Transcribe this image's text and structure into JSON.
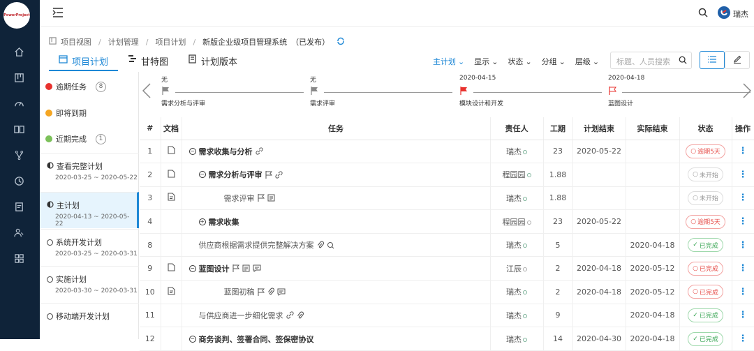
{
  "brand": {
    "logo_text": "PowerProject"
  },
  "sidebar": {
    "icons": [
      "home-icon",
      "board-icon",
      "dashboard-icon",
      "book-icon",
      "branch-icon",
      "clock-icon",
      "report-icon",
      "users-icon",
      "grid-icon"
    ]
  },
  "topbar": {
    "user_name": "瑞杰"
  },
  "breadcrumb": {
    "items": [
      "项目视图",
      "计划管理",
      "项目计划"
    ],
    "current": "新版企业级项目管理系统",
    "status": "（已发布）"
  },
  "tabs": [
    {
      "label": "项目计划",
      "active": true
    },
    {
      "label": "甘特图",
      "active": false
    },
    {
      "label": "计划版本",
      "active": false
    }
  ],
  "filters": [
    {
      "label": "主计划",
      "active": true
    },
    {
      "label": "显示"
    },
    {
      "label": "状态"
    },
    {
      "label": "分组"
    },
    {
      "label": "层级"
    }
  ],
  "search": {
    "placeholder": "标题、人员搜索"
  },
  "left_panel": {
    "alerts": [
      {
        "label": "逾期任务",
        "color": "#e8322e",
        "count": "8"
      },
      {
        "label": "即将到期",
        "color": "#f5a623",
        "count": ""
      },
      {
        "label": "近期完成",
        "color": "#7cc15a",
        "count": "1"
      }
    ],
    "plans": [
      {
        "name": "查看完整计划",
        "dates": "2020-03-25 ~ 2020-05-22",
        "active": false
      },
      {
        "name": "主计划",
        "dates": "2020-04-13 ~ 2020-05-22",
        "active": true
      },
      {
        "name": "系统开发计划",
        "dates": "2020-03-25 ~ 2020-03-31",
        "active": false
      },
      {
        "name": "实施计划",
        "dates": "2020-03-30 ~ 2020-03-31",
        "active": false
      },
      {
        "name": "移动端开发计划",
        "dates": "",
        "active": false
      }
    ]
  },
  "milestones": [
    {
      "date": "无",
      "name": "需求分析与评审",
      "flag_color": "#888"
    },
    {
      "date": "无",
      "name": "需求评审",
      "flag_color": "#888"
    },
    {
      "date": "2020-04-15",
      "name": "模块设计和开发",
      "flag_color": "#e8322e"
    },
    {
      "date": "2020-04-18",
      "name": "蓝图设计",
      "flag_color": "#e8322e"
    }
  ],
  "table": {
    "headers": [
      "#",
      "文档",
      "任务",
      "责任人",
      "工期",
      "计划结束",
      "实际结束",
      "状态",
      "操作"
    ],
    "rows": [
      {
        "num": "1",
        "doc": "doc",
        "indent": 0,
        "toggle": "minus",
        "bold": true,
        "task": "需求收集与分析",
        "icons": [
          "link"
        ],
        "owner": "瑞杰",
        "owner_ok": true,
        "duration": "23",
        "plan_end": "2020-05-22",
        "actual_end": "",
        "status": "逾期5天",
        "status_type": "red"
      },
      {
        "num": "2",
        "doc": "doc",
        "indent": 1,
        "toggle": "minus",
        "bold": true,
        "task": "需求分析与评审",
        "icons": [
          "flag",
          "link"
        ],
        "owner": "程园园",
        "owner_ok": true,
        "duration": "1.88",
        "plan_end": "",
        "actual_end": "",
        "status": "未开始",
        "status_type": "grey"
      },
      {
        "num": "3",
        "doc": "doc2",
        "indent": 2,
        "toggle": "",
        "bold": false,
        "task": "需求评审",
        "icons": [
          "flag",
          "list"
        ],
        "owner": "瑞杰",
        "owner_ok": true,
        "duration": "1.88",
        "plan_end": "",
        "actual_end": "",
        "status": "未开始",
        "status_type": "grey"
      },
      {
        "num": "4",
        "doc": "",
        "indent": 1,
        "toggle": "plus",
        "bold": true,
        "task": "需求收集",
        "icons": [],
        "owner": "程园园",
        "owner_ok": false,
        "duration": "23",
        "plan_end": "2020-05-22",
        "actual_end": "",
        "status": "逾期5天",
        "status_type": "red"
      },
      {
        "num": "8",
        "doc": "",
        "indent": 1,
        "toggle": "",
        "bold": false,
        "task": "供应商根据需求提供完整解决方案",
        "icons": [
          "clip",
          "search"
        ],
        "owner": "瑞杰",
        "owner_ok": true,
        "duration": "5",
        "plan_end": "",
        "actual_end": "2020-04-18",
        "status": "已完成",
        "status_type": "green"
      },
      {
        "num": "9",
        "doc": "doc",
        "indent": 0,
        "toggle": "minus",
        "bold": true,
        "task": "蓝图设计",
        "icons": [
          "flag",
          "list",
          "chat"
        ],
        "owner": "江辰",
        "owner_ok": false,
        "duration": "2",
        "plan_end": "2020-04-18",
        "actual_end": "2020-05-12",
        "status": "已完成",
        "status_type": "red"
      },
      {
        "num": "10",
        "doc": "doc2",
        "indent": 2,
        "toggle": "",
        "bold": false,
        "task": "蓝图初稿",
        "icons": [
          "flag",
          "clip",
          "chat"
        ],
        "owner": "瑞杰",
        "owner_ok": true,
        "duration": "2",
        "plan_end": "2020-04-18",
        "actual_end": "2020-05-12",
        "status": "已完成",
        "status_type": "red"
      },
      {
        "num": "11",
        "doc": "",
        "indent": 1,
        "toggle": "",
        "bold": false,
        "task": "与供应商进一步细化需求",
        "icons": [
          "link",
          "clip"
        ],
        "owner": "瑞杰",
        "owner_ok": true,
        "duration": "9",
        "plan_end": "",
        "actual_end": "2020-04-18",
        "status": "已完成",
        "status_type": "green"
      },
      {
        "num": "12",
        "doc": "",
        "indent": 0,
        "toggle": "minus",
        "bold": true,
        "task": "商务谈判、签署合同、签保密协议",
        "icons": [],
        "owner": "瑞杰",
        "owner_ok": true,
        "duration": "14",
        "plan_end": "2020-04-30",
        "actual_end": "2020-04-18",
        "status": "已完成",
        "status_type": "green"
      }
    ]
  }
}
